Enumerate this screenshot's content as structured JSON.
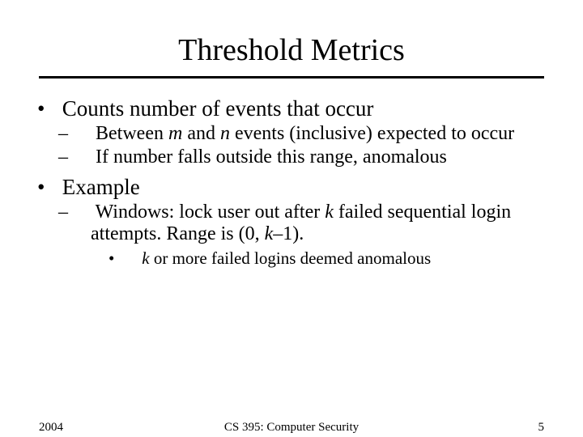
{
  "title": "Threshold Metrics",
  "bullets": {
    "b1": "Counts number of events that occur",
    "b1_1_pre": "Between ",
    "b1_1_m": "m",
    "b1_1_mid": " and ",
    "b1_1_n": "n",
    "b1_1_post": " events (inclusive) expected to occur",
    "b1_2": "If number falls outside this range, anomalous",
    "b2": "Example",
    "b2_1_pre": "Windows: lock user out after ",
    "b2_1_k": "k",
    "b2_1_mid": " failed sequential login attempts. Range is (0, ",
    "b2_1_k2": "k",
    "b2_1_post": "–1).",
    "b2_1_1_k": "k",
    "b2_1_1_post": " or more failed logins deemed anomalous"
  },
  "footer": {
    "year": "2004",
    "course": "CS 395: Computer Security",
    "slide_number": "5"
  }
}
